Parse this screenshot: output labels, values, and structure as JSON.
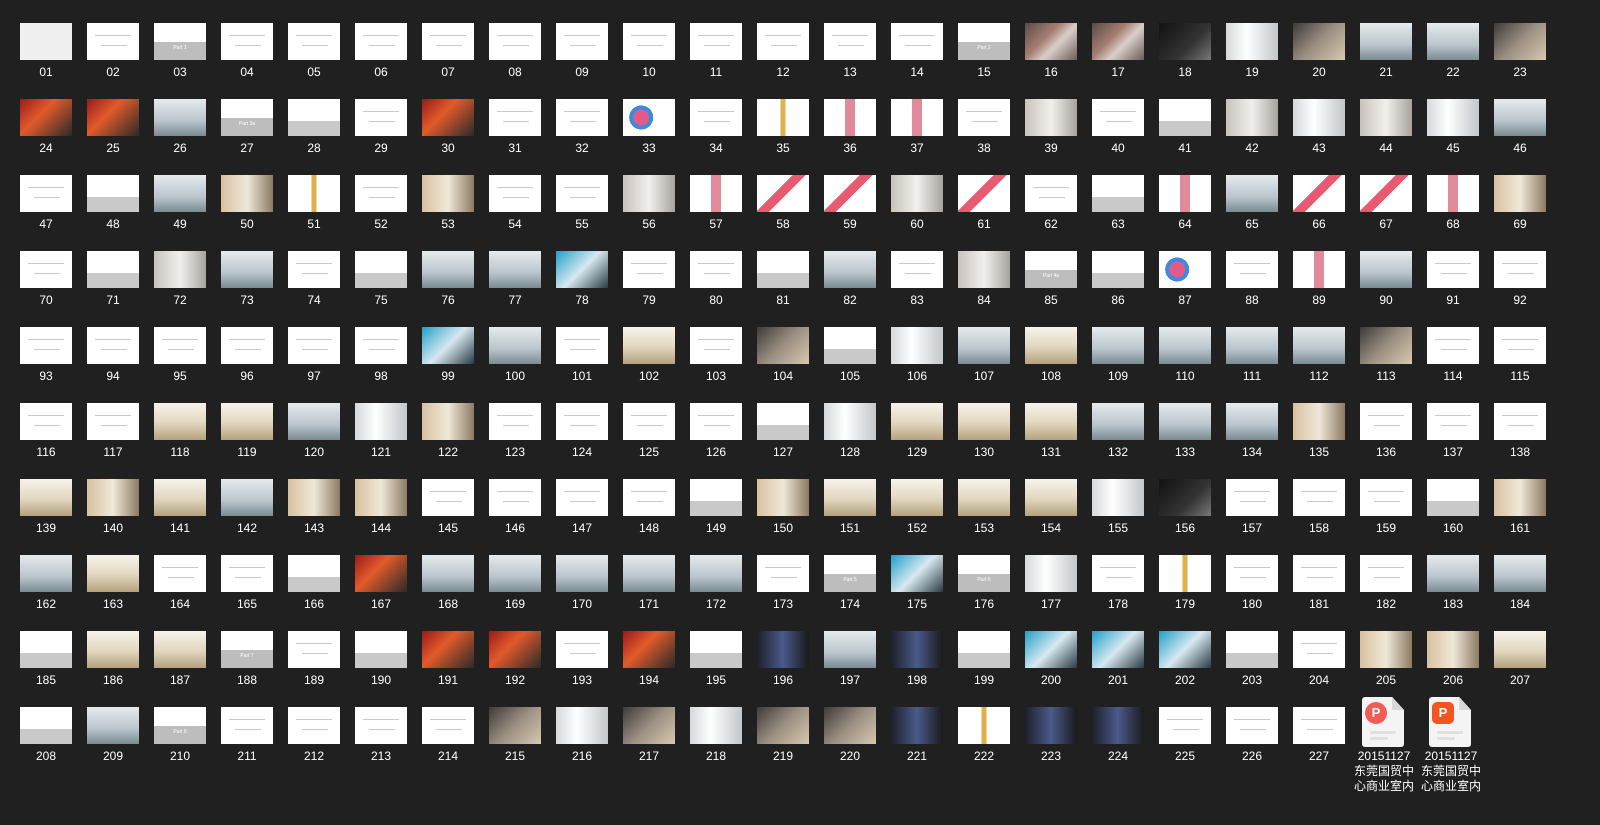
{
  "explorer": {
    "slides": [
      {
        "label": "01",
        "style": "logo"
      },
      {
        "label": "02",
        "style": "lines"
      },
      {
        "label": "03",
        "style": "section",
        "band": "Part 1"
      },
      {
        "label": "04",
        "style": "lines"
      },
      {
        "label": "05",
        "style": "lines"
      },
      {
        "label": "06",
        "style": "lines"
      },
      {
        "label": "07",
        "style": "lines"
      },
      {
        "label": "08",
        "style": "lines"
      },
      {
        "label": "09",
        "style": "lines"
      },
      {
        "label": "10",
        "style": "lines"
      },
      {
        "label": "11",
        "style": "lines"
      },
      {
        "label": "12",
        "style": "lines"
      },
      {
        "label": "13",
        "style": "lines"
      },
      {
        "label": "14",
        "style": "lines"
      },
      {
        "label": "15",
        "style": "section",
        "band": "Part 2"
      },
      {
        "label": "16",
        "style": "p1"
      },
      {
        "label": "17",
        "style": "p1"
      },
      {
        "label": "18",
        "style": "p11"
      },
      {
        "label": "19",
        "style": "p5"
      },
      {
        "label": "20",
        "style": "p4"
      },
      {
        "label": "21",
        "style": "p3"
      },
      {
        "label": "22",
        "style": "p3"
      },
      {
        "label": "23",
        "style": "p4"
      },
      {
        "label": "24",
        "style": "p6"
      },
      {
        "label": "25",
        "style": "p6"
      },
      {
        "label": "26",
        "style": "p3"
      },
      {
        "label": "27",
        "style": "section",
        "band": "Part 3a"
      },
      {
        "label": "28",
        "style": "p14"
      },
      {
        "label": "29",
        "style": "lines"
      },
      {
        "label": "30",
        "style": "p6"
      },
      {
        "label": "31",
        "style": "lines"
      },
      {
        "label": "32",
        "style": "lines"
      },
      {
        "label": "33",
        "style": "p15"
      },
      {
        "label": "34",
        "style": "lines"
      },
      {
        "label": "35",
        "style": "p12"
      },
      {
        "label": "36",
        "style": "p13"
      },
      {
        "label": "37",
        "style": "p13"
      },
      {
        "label": "38",
        "style": "lines"
      },
      {
        "label": "39",
        "style": "p2"
      },
      {
        "label": "40",
        "style": "lines"
      },
      {
        "label": "41",
        "style": "p14"
      },
      {
        "label": "42",
        "style": "p2"
      },
      {
        "label": "43",
        "style": "p5"
      },
      {
        "label": "44",
        "style": "p2"
      },
      {
        "label": "45",
        "style": "p5"
      },
      {
        "label": "46",
        "style": "p3"
      },
      {
        "label": "47",
        "style": "lines"
      },
      {
        "label": "48",
        "style": "p14"
      },
      {
        "label": "49",
        "style": "p3"
      },
      {
        "label": "50",
        "style": "p10"
      },
      {
        "label": "51",
        "style": "p12"
      },
      {
        "label": "52",
        "style": "lines"
      },
      {
        "label": "53",
        "style": "p10"
      },
      {
        "label": "54",
        "style": "lines"
      },
      {
        "label": "55",
        "style": "lines"
      },
      {
        "label": "56",
        "style": "p2"
      },
      {
        "label": "57",
        "style": "p13"
      },
      {
        "label": "58",
        "style": "p16"
      },
      {
        "label": "59",
        "style": "p16"
      },
      {
        "label": "60",
        "style": "p2"
      },
      {
        "label": "61",
        "style": "p16"
      },
      {
        "label": "62",
        "style": "lines"
      },
      {
        "label": "63",
        "style": "p14"
      },
      {
        "label": "64",
        "style": "p13"
      },
      {
        "label": "65",
        "style": "p3"
      },
      {
        "label": "66",
        "style": "p16"
      },
      {
        "label": "67",
        "style": "p16"
      },
      {
        "label": "68",
        "style": "p13"
      },
      {
        "label": "69",
        "style": "p10"
      },
      {
        "label": "70",
        "style": "lines"
      },
      {
        "label": "71",
        "style": "p14"
      },
      {
        "label": "72",
        "style": "p2"
      },
      {
        "label": "73",
        "style": "p3"
      },
      {
        "label": "74",
        "style": "lines"
      },
      {
        "label": "75",
        "style": "p14"
      },
      {
        "label": "76",
        "style": "p3"
      },
      {
        "label": "77",
        "style": "p3"
      },
      {
        "label": "78",
        "style": "p8"
      },
      {
        "label": "79",
        "style": "lines"
      },
      {
        "label": "80",
        "style": "lines"
      },
      {
        "label": "81",
        "style": "p14"
      },
      {
        "label": "82",
        "style": "p3"
      },
      {
        "label": "83",
        "style": "lines"
      },
      {
        "label": "84",
        "style": "p2"
      },
      {
        "label": "85",
        "style": "section",
        "band": "Part 4a"
      },
      {
        "label": "86",
        "style": "p14"
      },
      {
        "label": "87",
        "style": "p15"
      },
      {
        "label": "88",
        "style": "lines"
      },
      {
        "label": "89",
        "style": "p13"
      },
      {
        "label": "90",
        "style": "p3"
      },
      {
        "label": "91",
        "style": "lines"
      },
      {
        "label": "92",
        "style": "lines"
      },
      {
        "label": "93",
        "style": "lines"
      },
      {
        "label": "94",
        "style": "lines"
      },
      {
        "label": "95",
        "style": "lines"
      },
      {
        "label": "96",
        "style": "lines"
      },
      {
        "label": "97",
        "style": "lines"
      },
      {
        "label": "98",
        "style": "lines"
      },
      {
        "label": "99",
        "style": "p8"
      },
      {
        "label": "100",
        "style": "p3"
      },
      {
        "label": "101",
        "style": "lines"
      },
      {
        "label": "102",
        "style": "p9"
      },
      {
        "label": "103",
        "style": "lines"
      },
      {
        "label": "104",
        "style": "p4"
      },
      {
        "label": "105",
        "style": "p14"
      },
      {
        "label": "106",
        "style": "p5"
      },
      {
        "label": "107",
        "style": "p3"
      },
      {
        "label": "108",
        "style": "p9"
      },
      {
        "label": "109",
        "style": "p3"
      },
      {
        "label": "110",
        "style": "p3"
      },
      {
        "label": "111",
        "style": "p3"
      },
      {
        "label": "112",
        "style": "p3"
      },
      {
        "label": "113",
        "style": "p4"
      },
      {
        "label": "114",
        "style": "lines"
      },
      {
        "label": "115",
        "style": "lines"
      },
      {
        "label": "116",
        "style": "lines"
      },
      {
        "label": "117",
        "style": "lines"
      },
      {
        "label": "118",
        "style": "p9"
      },
      {
        "label": "119",
        "style": "p9"
      },
      {
        "label": "120",
        "style": "p3"
      },
      {
        "label": "121",
        "style": "p5"
      },
      {
        "label": "122",
        "style": "p10"
      },
      {
        "label": "123",
        "style": "lines"
      },
      {
        "label": "124",
        "style": "lines"
      },
      {
        "label": "125",
        "style": "lines"
      },
      {
        "label": "126",
        "style": "lines"
      },
      {
        "label": "127",
        "style": "p14"
      },
      {
        "label": "128",
        "style": "p5"
      },
      {
        "label": "129",
        "style": "p9"
      },
      {
        "label": "130",
        "style": "p9"
      },
      {
        "label": "131",
        "style": "p9"
      },
      {
        "label": "132",
        "style": "p3"
      },
      {
        "label": "133",
        "style": "p3"
      },
      {
        "label": "134",
        "style": "p3"
      },
      {
        "label": "135",
        "style": "p10"
      },
      {
        "label": "136",
        "style": "lines"
      },
      {
        "label": "137",
        "style": "lines"
      },
      {
        "label": "138",
        "style": "lines"
      },
      {
        "label": "139",
        "style": "p9"
      },
      {
        "label": "140",
        "style": "p10"
      },
      {
        "label": "141",
        "style": "p9"
      },
      {
        "label": "142",
        "style": "p3"
      },
      {
        "label": "143",
        "style": "p10"
      },
      {
        "label": "144",
        "style": "p10"
      },
      {
        "label": "145",
        "style": "lines"
      },
      {
        "label": "146",
        "style": "lines"
      },
      {
        "label": "147",
        "style": "lines"
      },
      {
        "label": "148",
        "style": "lines"
      },
      {
        "label": "149",
        "style": "p14"
      },
      {
        "label": "150",
        "style": "p10"
      },
      {
        "label": "151",
        "style": "p9"
      },
      {
        "label": "152",
        "style": "p9"
      },
      {
        "label": "153",
        "style": "p9"
      },
      {
        "label": "154",
        "style": "p9"
      },
      {
        "label": "155",
        "style": "p5"
      },
      {
        "label": "156",
        "style": "p11"
      },
      {
        "label": "157",
        "style": "lines"
      },
      {
        "label": "158",
        "style": "lines"
      },
      {
        "label": "159",
        "style": "lines"
      },
      {
        "label": "160",
        "style": "p14"
      },
      {
        "label": "161",
        "style": "p10"
      },
      {
        "label": "162",
        "style": "p3"
      },
      {
        "label": "163",
        "style": "p9"
      },
      {
        "label": "164",
        "style": "lines"
      },
      {
        "label": "165",
        "style": "lines"
      },
      {
        "label": "166",
        "style": "p14"
      },
      {
        "label": "167",
        "style": "p6"
      },
      {
        "label": "168",
        "style": "p3"
      },
      {
        "label": "169",
        "style": "p3"
      },
      {
        "label": "170",
        "style": "p3"
      },
      {
        "label": "171",
        "style": "p3"
      },
      {
        "label": "172",
        "style": "p3"
      },
      {
        "label": "173",
        "style": "lines"
      },
      {
        "label": "174",
        "style": "section",
        "band": "Part 5"
      },
      {
        "label": "175",
        "style": "p8"
      },
      {
        "label": "176",
        "style": "section",
        "band": "Part 6"
      },
      {
        "label": "177",
        "style": "p5"
      },
      {
        "label": "178",
        "style": "lines"
      },
      {
        "label": "179",
        "style": "p12"
      },
      {
        "label": "180",
        "style": "lines"
      },
      {
        "label": "181",
        "style": "lines"
      },
      {
        "label": "182",
        "style": "lines"
      },
      {
        "label": "183",
        "style": "p3"
      },
      {
        "label": "184",
        "style": "p3"
      },
      {
        "label": "185",
        "style": "p14"
      },
      {
        "label": "186",
        "style": "p9"
      },
      {
        "label": "187",
        "style": "p9"
      },
      {
        "label": "188",
        "style": "section",
        "band": "Part 7"
      },
      {
        "label": "189",
        "style": "lines"
      },
      {
        "label": "190",
        "style": "p14"
      },
      {
        "label": "191",
        "style": "p6"
      },
      {
        "label": "192",
        "style": "p6"
      },
      {
        "label": "193",
        "style": "lines"
      },
      {
        "label": "194",
        "style": "p6"
      },
      {
        "label": "195",
        "style": "p14"
      },
      {
        "label": "196",
        "style": "p7"
      },
      {
        "label": "197",
        "style": "p3"
      },
      {
        "label": "198",
        "style": "p7"
      },
      {
        "label": "199",
        "style": "p14"
      },
      {
        "label": "200",
        "style": "p8"
      },
      {
        "label": "201",
        "style": "p8"
      },
      {
        "label": "202",
        "style": "p8"
      },
      {
        "label": "203",
        "style": "p14"
      },
      {
        "label": "204",
        "style": "lines"
      },
      {
        "label": "205",
        "style": "p10"
      },
      {
        "label": "206",
        "style": "p10"
      },
      {
        "label": "207",
        "style": "p9"
      },
      {
        "label": "208",
        "style": "p14"
      },
      {
        "label": "209",
        "style": "p3"
      },
      {
        "label": "210",
        "style": "section",
        "band": "Part 8"
      },
      {
        "label": "211",
        "style": "lines"
      },
      {
        "label": "212",
        "style": "lines"
      },
      {
        "label": "213",
        "style": "lines"
      },
      {
        "label": "214",
        "style": "lines"
      },
      {
        "label": "215",
        "style": "p4"
      },
      {
        "label": "216",
        "style": "p5"
      },
      {
        "label": "217",
        "style": "p4"
      },
      {
        "label": "218",
        "style": "p5"
      },
      {
        "label": "219",
        "style": "p4"
      },
      {
        "label": "220",
        "style": "p4"
      },
      {
        "label": "221",
        "style": "p7"
      },
      {
        "label": "222",
        "style": "p12"
      },
      {
        "label": "223",
        "style": "p7"
      },
      {
        "label": "224",
        "style": "p7"
      },
      {
        "label": "225",
        "style": "lines"
      },
      {
        "label": "226",
        "style": "lines"
      },
      {
        "label": "227",
        "style": "lines"
      }
    ],
    "files": [
      {
        "label": "20151127东莞国贸中心商业室内",
        "icon": "pdf-file-icon",
        "badge": "P",
        "shape": "round"
      },
      {
        "label": "20151127东莞国贸中心商业室内",
        "icon": "wps-ppt-file-icon",
        "badge": "P",
        "shape": "square"
      }
    ]
  }
}
